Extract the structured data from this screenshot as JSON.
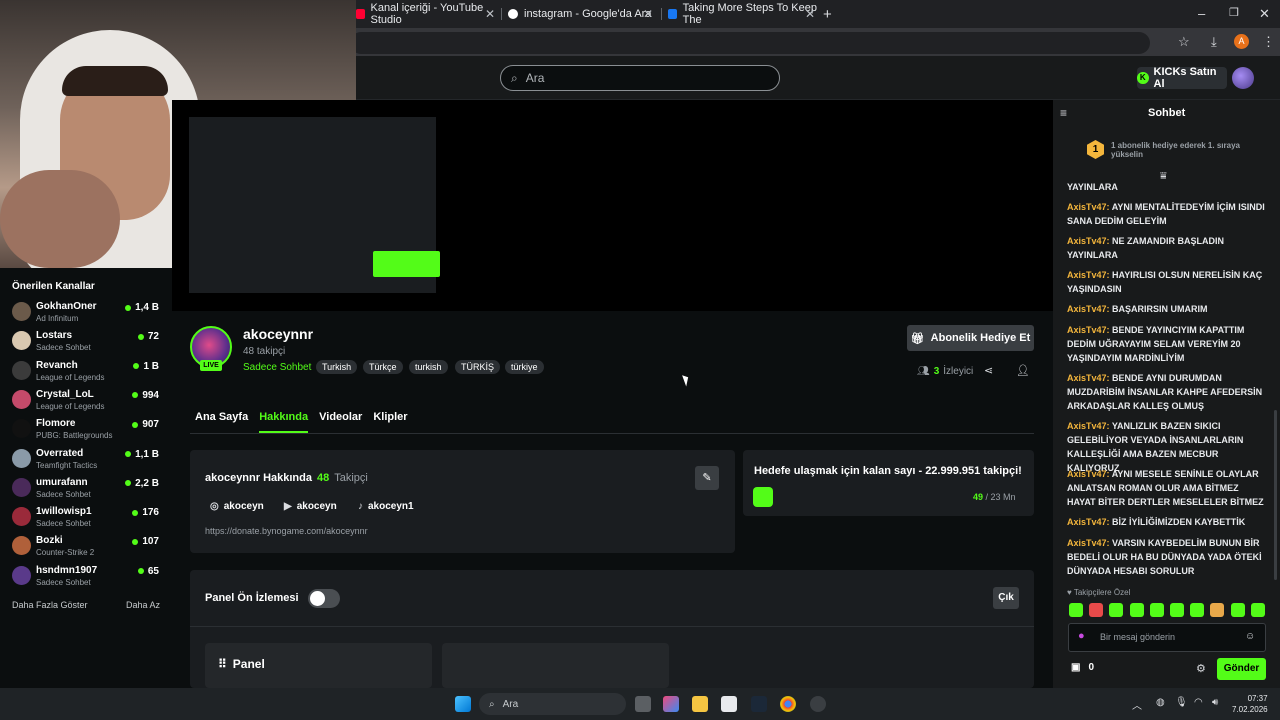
{
  "browser": {
    "tabs": [
      {
        "title": "Kanal içeriği - YouTube Studio"
      },
      {
        "title": "instagram - Google'da Ara"
      },
      {
        "title": "Taking More Steps To Keep The"
      }
    ],
    "new_tab": "+",
    "profile_initial": "A"
  },
  "site": {
    "search_placeholder": "Ara",
    "kicks_label": "KICKs Satın Al"
  },
  "sidebar": {
    "title": "Önerilen Kanallar",
    "channels": [
      {
        "name": "GokhanOner",
        "sub": "Ad Infinitum",
        "viewers": "1,4 B",
        "color": "#6b5a4a"
      },
      {
        "name": "Lostars",
        "sub": "Sadece Sohbet",
        "viewers": "72",
        "color": "#d9c8b0"
      },
      {
        "name": "Revanch",
        "sub": "League of Legends",
        "viewers": "1 B",
        "color": "#3b3b3b"
      },
      {
        "name": "Crystal_LoL",
        "sub": "League of Legends",
        "viewers": "994",
        "color": "#c44a6a"
      },
      {
        "name": "Flomore",
        "sub": "PUBG: Battlegrounds",
        "viewers": "907",
        "color": "#111111"
      },
      {
        "name": "Overrated",
        "sub": "Teamfight Tactics",
        "viewers": "1,1 B",
        "color": "#8a9aa8"
      },
      {
        "name": "umurafann",
        "sub": "Sadece Sohbet",
        "viewers": "2,2 B",
        "color": "#4a2a5a"
      },
      {
        "name": "1willowisp1",
        "sub": "Sadece Sohbet",
        "viewers": "176",
        "color": "#9a2a3a"
      },
      {
        "name": "Bozki",
        "sub": "Counter-Strike 2",
        "viewers": "107",
        "color": "#b0603a"
      },
      {
        "name": "hsndmn1907",
        "sub": "Sadece Sohbet",
        "viewers": "65",
        "color": "#5a3a8a"
      }
    ],
    "show_more": "Daha Fazla Göster",
    "show_less": "Daha Az"
  },
  "channel": {
    "name": "akoceynnr",
    "followers": "48 takipçi",
    "live": "LIVE",
    "category": "Sadece Sohbet",
    "tags": [
      "Turkish",
      "Türkçe",
      "turkish",
      "TÜRKİŞ",
      "türkiye"
    ],
    "gift_label": "Abonelik Hediye Et",
    "viewers_count": "3",
    "viewers_label": "İzleyici"
  },
  "tabs": [
    "Ana Sayfa",
    "Hakkında",
    "Videolar",
    "Klipler"
  ],
  "about": {
    "title": "akoceynnr Hakkında",
    "follower_num": "48",
    "follower_lbl": "Takipçi",
    "instagram": "akoceyn",
    "youtube": "akoceyn",
    "tiktok": "akoceyn1",
    "link": "https://donate.bynogame.com/akoceynnr"
  },
  "goal": {
    "text": "Hedefe ulaşmak için kalan sayı - 22.999.951 takipçi!",
    "current": "49",
    "target": "/ 23 Mn"
  },
  "panel": {
    "preview_label": "Panel Ön İzlemesi",
    "exit_label": "Çık",
    "panel_name": "Panel"
  },
  "chat": {
    "title": "Sohbet",
    "pin_rank": "1",
    "pin_text": "1 abonelik hediye ederek 1. sıraya yükselin",
    "messages": [
      {
        "user": "",
        "text": "YAYINLARA"
      },
      {
        "user": "AxisTv47:",
        "text": "AYNI MENTALİTEDEYİM İÇİM ISINDI SANA DEDİM GELEYİM"
      },
      {
        "user": "AxisTv47:",
        "text": "NE ZAMANDIR BAŞLADIN YAYINLARA"
      },
      {
        "user": "AxisTv47:",
        "text": "HAYIRLISI OLSUN NERELİSİN KAÇ YAŞINDASIN"
      },
      {
        "user": "AxisTv47:",
        "text": "BAŞARIRSIN UMARIM"
      },
      {
        "user": "AxisTv47:",
        "text": "BENDE YAYINCIYIM KAPATTIM DEDİM UĞRAYAYIM SELAM VEREYİM 20 YAŞINDAYIM MARDİNLİYİM"
      },
      {
        "user": "AxisTv47:",
        "text": "BENDE AYNI DURUMDAN MUZDARİBİM İNSANLAR KAHPE AFEDERSİN ARKADAŞLAR KALLEŞ OLMUŞ"
      },
      {
        "user": "AxisTv47:",
        "text": "YANLIZLIK BAZEN SIKICI GELEBİLİYOR VEYADA İNSANLARLARIN KALLEŞLİĞİ AMA BAZEN MECBUR KALIYORUZ"
      },
      {
        "user": "AxisTv47:",
        "text": "AYNI MESELE SENİNLE OLAYLAR ANLATSAN ROMAN OLUR AMA BİTMEZ HAYAT BİTER DERTLER MESELELER BİTMEZ"
      },
      {
        "user": "AxisTv47:",
        "text": "BİZ İYİLİĞİMİZDEN KAYBETTİK"
      },
      {
        "user": "AxisTv47:",
        "text": "VARSIN KAYBEDELİM BUNUN BİR BEDELİ OLUR HA BU DÜNYADA YADA ÖTEKİ DÜNYADA HESABI SORULUR"
      }
    ],
    "emote_label": "♥ Takipçilere Özel",
    "input_placeholder": "Bir mesaj gönderin",
    "kicks_count": "0",
    "send_label": "Gönder"
  },
  "taskbar": {
    "search": "Ara",
    "time": "07:37",
    "date": "7.02.2026"
  }
}
